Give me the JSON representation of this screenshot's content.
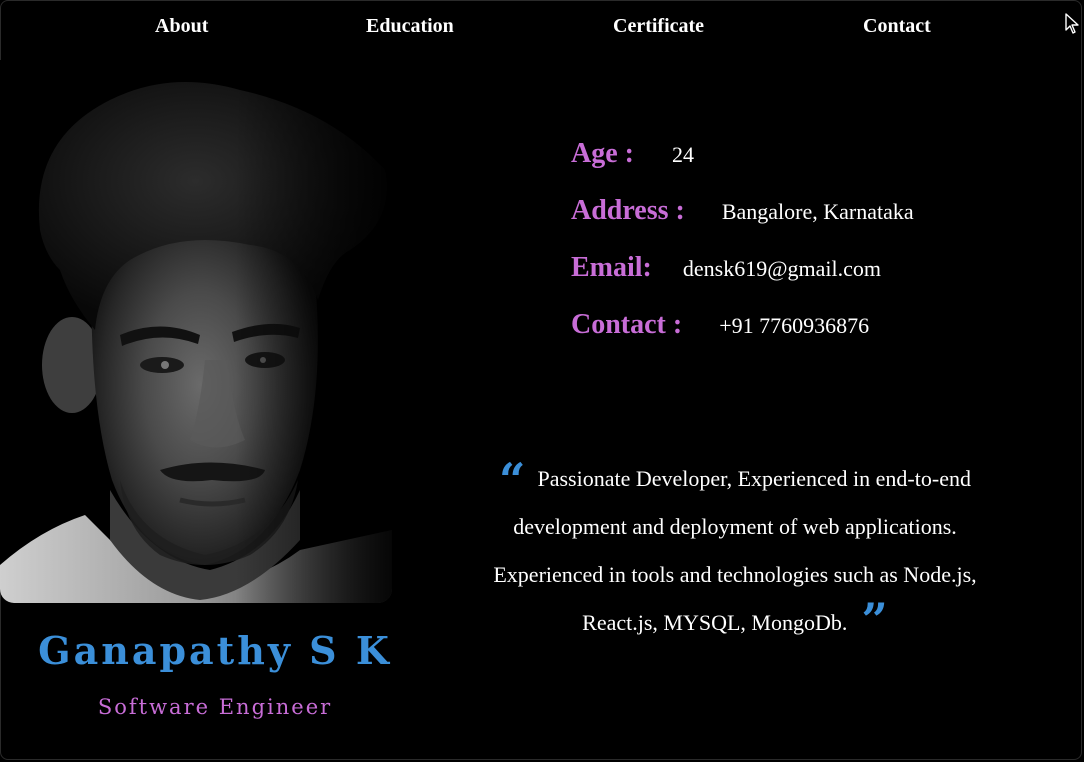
{
  "nav": {
    "items": [
      {
        "label": "About"
      },
      {
        "label": "Education"
      },
      {
        "label": "Certificate"
      },
      {
        "label": "Contact"
      }
    ]
  },
  "profile": {
    "name": "Ganapathy S K",
    "role": "Software Engineer"
  },
  "info": {
    "age_label": "Age :",
    "age_value": "24",
    "address_label": "Address :",
    "address_value": "Bangalore, Karnataka",
    "email_label": "Email:",
    "email_value": "densk619@gmail.com",
    "contact_label": "Contact :",
    "contact_value": "+91 7760936876"
  },
  "quote": {
    "open_mark": "“",
    "text_line1": "Passionate Developer, Experienced in end-to-end",
    "text_line2": "development and deployment of web applications.",
    "text_line3": "Experienced in tools and technologies such as Node.js,",
    "text_line4": "React.js, MYSQL, MongoDb.",
    "close_mark": "”"
  },
  "colors": {
    "background": "#000000",
    "name_blue": "#3b8fd9",
    "label_purple": "#c86dd7",
    "text_white": "#ffffff"
  },
  "icons": {
    "cursor": "mouse-pointer-icon",
    "quote_open": "quote-open-icon",
    "quote_close": "quote-close-icon"
  }
}
